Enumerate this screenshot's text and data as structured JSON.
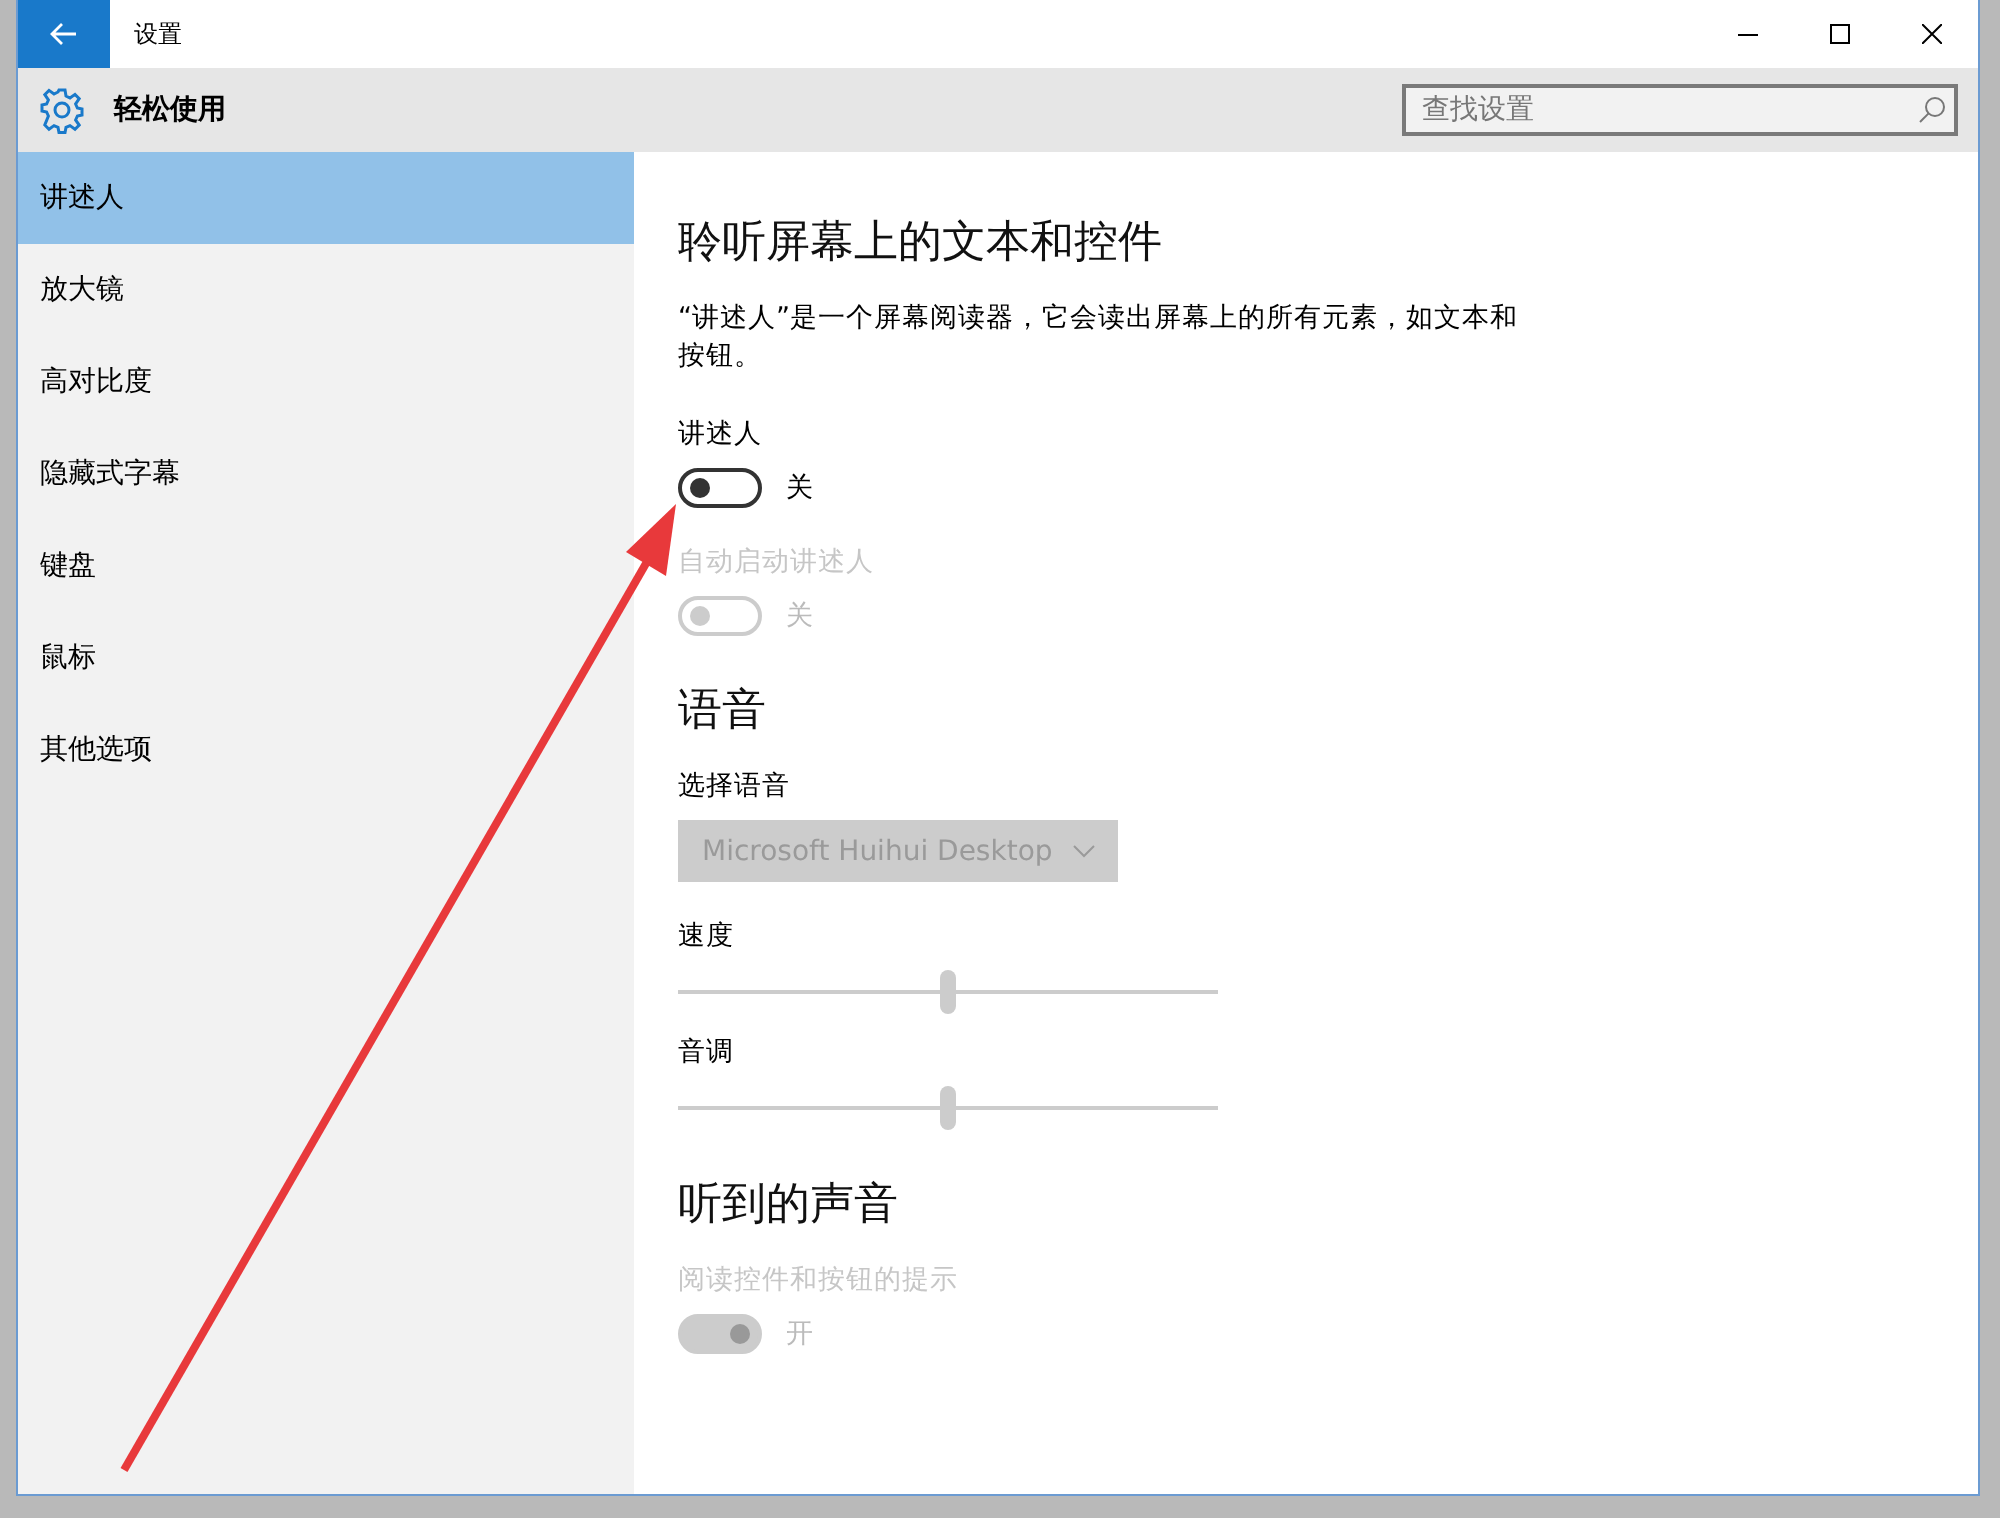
{
  "window": {
    "title": "设置"
  },
  "header": {
    "title": "轻松使用",
    "search": {
      "placeholder": "查找设置"
    }
  },
  "sidebar": {
    "items": [
      {
        "label": "讲述人",
        "selected": true
      },
      {
        "label": "放大镜",
        "selected": false
      },
      {
        "label": "高对比度",
        "selected": false
      },
      {
        "label": "隐藏式字幕",
        "selected": false
      },
      {
        "label": "键盘",
        "selected": false
      },
      {
        "label": "鼠标",
        "selected": false
      },
      {
        "label": "其他选项",
        "selected": false
      }
    ]
  },
  "sections": [
    {
      "heading": "聆听屏幕上的文本和控件",
      "description": "“讲述人”是一个屏幕阅读器，它会读出屏幕上的所有元素，如文本和按钮。",
      "settings": [
        {
          "kind": "toggle",
          "label": "讲述人",
          "on": false,
          "disabled": false,
          "state_text": "关"
        },
        {
          "kind": "toggle",
          "label": "自动启动讲述人",
          "on": false,
          "disabled": true,
          "state_text": "关"
        }
      ]
    },
    {
      "heading": "语音",
      "settings": [
        {
          "kind": "dropdown",
          "label": "选择语音",
          "value": "Microsoft Huihui Desktop",
          "disabled": true
        },
        {
          "kind": "slider",
          "label": "速度",
          "level": 0.5,
          "disabled": true
        },
        {
          "kind": "slider",
          "label": "音调",
          "level": 0.5,
          "disabled": true
        }
      ]
    },
    {
      "heading": "听到的声音",
      "settings": [
        {
          "kind": "toggle",
          "label": "阅读控件和按钮的提示",
          "on": true,
          "disabled": true,
          "state_text": "开"
        }
      ]
    }
  ]
}
